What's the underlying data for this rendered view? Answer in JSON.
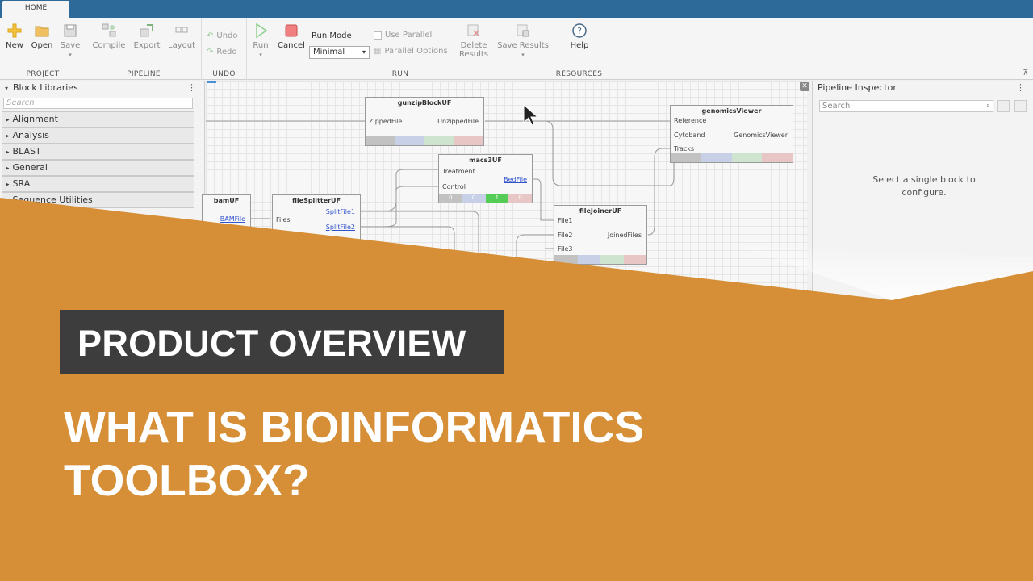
{
  "tab": {
    "home": "HOME"
  },
  "ribbon": {
    "project": {
      "label": "PROJECT",
      "new": "New",
      "open": "Open",
      "save": "Save"
    },
    "pipeline": {
      "label": "PIPELINE",
      "compile": "Compile",
      "export": "Export",
      "layout": "Layout"
    },
    "undo": {
      "label": "UNDO",
      "undo": "Undo",
      "redo": "Redo"
    },
    "run": {
      "label": "RUN",
      "run": "Run",
      "cancel": "Cancel",
      "run_mode_label": "Run Mode",
      "run_mode_value": "Minimal",
      "use_parallel": "Use Parallel",
      "parallel_options": "Parallel Options",
      "delete_results_1": "Delete",
      "delete_results_2": "Results",
      "save_results": "Save Results"
    },
    "resources": {
      "label": "RESOURCES",
      "help": "Help"
    }
  },
  "libraries": {
    "title": "Block Libraries",
    "search_placeholder": "Search",
    "items": [
      "Alignment",
      "Analysis",
      "BLAST",
      "General",
      "SRA",
      "Sequence Utilities"
    ]
  },
  "blocks": {
    "gunzip": {
      "title": "gunzipBlockUF",
      "in": "ZippedFile",
      "out": "UnzippedFile"
    },
    "genomics": {
      "title": "genomicsViewer",
      "in1": "Reference",
      "in2": "Cytoband",
      "in3": "Tracks",
      "out": "GenomicsViewer"
    },
    "macs3": {
      "title": "macs3UF",
      "in1": "Treatment",
      "in2": "Control",
      "out": "BedFile",
      "c1": "0",
      "c2": "0",
      "c3": "1",
      "c4": "0"
    },
    "bam": {
      "title": "bamUF",
      "out": "BAMFile"
    },
    "splitter": {
      "title": "fileSplitterUF",
      "in": "Files",
      "out1": "SplitFile1",
      "out2": "SplitFile2"
    },
    "joiner": {
      "title": "fileJoinerUF",
      "in1": "File1",
      "in2": "File2",
      "in3": "File3",
      "out": "JoinedFiles"
    }
  },
  "inspector": {
    "title": "Pipeline Inspector",
    "search_placeholder": "Search",
    "message": "Select a single block to configure."
  },
  "overlay": {
    "label": "PRODUCT OVERVIEW",
    "title": "WHAT IS BIOINFORMATICS TOOLBOX?",
    "color": "#d68f36"
  }
}
